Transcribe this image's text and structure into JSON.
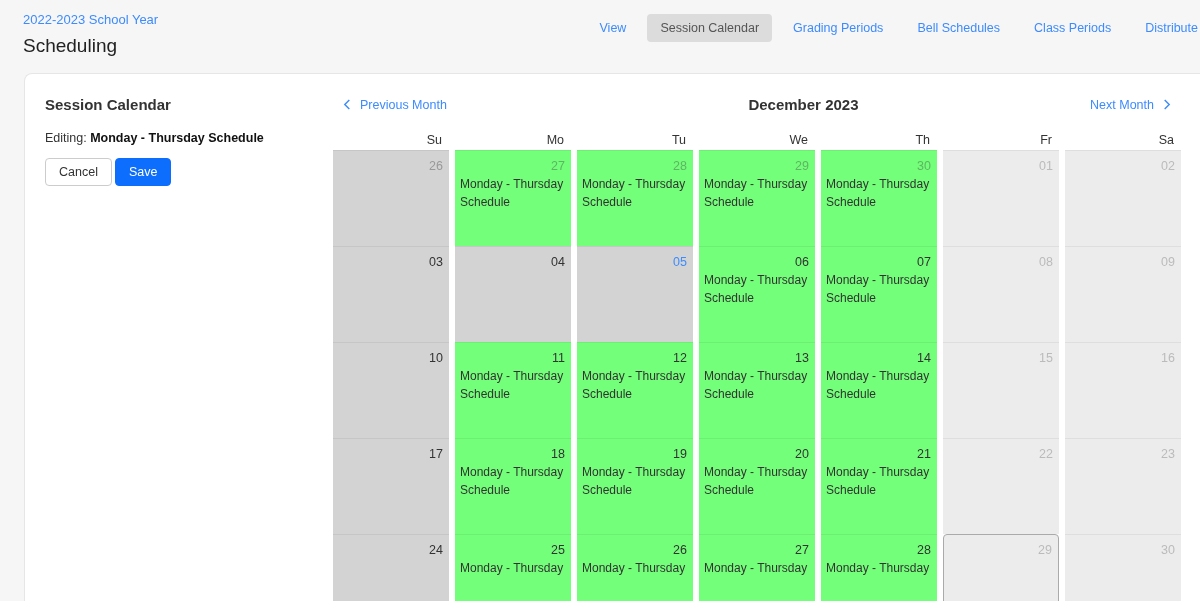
{
  "header": {
    "breadcrumb": "2022-2023 School Year",
    "title": "Scheduling"
  },
  "tabs": [
    {
      "label": "View",
      "selected": false
    },
    {
      "label": "Session Calendar",
      "selected": true
    },
    {
      "label": "Grading Periods",
      "selected": false
    },
    {
      "label": "Bell Schedules",
      "selected": false
    },
    {
      "label": "Class Periods",
      "selected": false
    },
    {
      "label": "Distribute",
      "selected": false
    }
  ],
  "panel": {
    "title": "Session Calendar",
    "editing_label": "Editing:",
    "editing_value": "Monday - Thursday Schedule",
    "buttons": [
      {
        "label": "Cancel",
        "kind": "secondary"
      },
      {
        "label": "Save",
        "kind": "primary"
      }
    ]
  },
  "calendar": {
    "prev": "Previous Month",
    "month": "December 2023",
    "next": "Next Month",
    "weekdays": [
      "Su",
      "Mo",
      "Tu",
      "We",
      "Th",
      "Fr",
      "Sa"
    ],
    "weeks": [
      [
        {
          "day": "26",
          "scheduled": false,
          "weekend": false,
          "outside": true,
          "today": false,
          "selected": false
        },
        {
          "day": "27",
          "scheduled": true,
          "weekend": false,
          "outside": true,
          "today": false,
          "selected": false,
          "schedule": "Monday - Thursday Schedule"
        },
        {
          "day": "28",
          "scheduled": true,
          "weekend": false,
          "outside": true,
          "today": false,
          "selected": false,
          "schedule": "Monday - Thursday Schedule"
        },
        {
          "day": "29",
          "scheduled": true,
          "weekend": false,
          "outside": true,
          "today": false,
          "selected": false,
          "schedule": "Monday - Thursday Schedule"
        },
        {
          "day": "30",
          "scheduled": true,
          "weekend": false,
          "outside": true,
          "today": false,
          "selected": false,
          "schedule": "Monday - Thursday Schedule"
        },
        {
          "day": "01",
          "scheduled": false,
          "weekend": true,
          "outside": false,
          "today": false,
          "selected": false
        },
        {
          "day": "02",
          "scheduled": false,
          "weekend": true,
          "outside": false,
          "today": false,
          "selected": false
        }
      ],
      [
        {
          "day": "03",
          "scheduled": false,
          "weekend": false,
          "outside": false,
          "today": false,
          "selected": false
        },
        {
          "day": "04",
          "scheduled": false,
          "weekend": false,
          "outside": false,
          "today": false,
          "selected": false
        },
        {
          "day": "05",
          "scheduled": false,
          "weekend": false,
          "outside": false,
          "today": true,
          "selected": false
        },
        {
          "day": "06",
          "scheduled": true,
          "weekend": false,
          "outside": false,
          "today": false,
          "selected": false,
          "schedule": "Monday - Thursday Schedule"
        },
        {
          "day": "07",
          "scheduled": true,
          "weekend": false,
          "outside": false,
          "today": false,
          "selected": false,
          "schedule": "Monday - Thursday Schedule"
        },
        {
          "day": "08",
          "scheduled": false,
          "weekend": true,
          "outside": false,
          "today": false,
          "selected": false
        },
        {
          "day": "09",
          "scheduled": false,
          "weekend": true,
          "outside": false,
          "today": false,
          "selected": false
        }
      ],
      [
        {
          "day": "10",
          "scheduled": false,
          "weekend": false,
          "outside": false,
          "today": false,
          "selected": false
        },
        {
          "day": "11",
          "scheduled": true,
          "weekend": false,
          "outside": false,
          "today": false,
          "selected": false,
          "schedule": "Monday - Thursday Schedule"
        },
        {
          "day": "12",
          "scheduled": true,
          "weekend": false,
          "outside": false,
          "today": false,
          "selected": false,
          "schedule": "Monday - Thursday Schedule"
        },
        {
          "day": "13",
          "scheduled": true,
          "weekend": false,
          "outside": false,
          "today": false,
          "selected": false,
          "schedule": "Monday - Thursday Schedule"
        },
        {
          "day": "14",
          "scheduled": true,
          "weekend": false,
          "outside": false,
          "today": false,
          "selected": false,
          "schedule": "Monday - Thursday Schedule"
        },
        {
          "day": "15",
          "scheduled": false,
          "weekend": true,
          "outside": false,
          "today": false,
          "selected": false
        },
        {
          "day": "16",
          "scheduled": false,
          "weekend": true,
          "outside": false,
          "today": false,
          "selected": false
        }
      ],
      [
        {
          "day": "17",
          "scheduled": false,
          "weekend": false,
          "outside": false,
          "today": false,
          "selected": false
        },
        {
          "day": "18",
          "scheduled": true,
          "weekend": false,
          "outside": false,
          "today": false,
          "selected": false,
          "schedule": "Monday - Thursday Schedule"
        },
        {
          "day": "19",
          "scheduled": true,
          "weekend": false,
          "outside": false,
          "today": false,
          "selected": false,
          "schedule": "Monday - Thursday Schedule"
        },
        {
          "day": "20",
          "scheduled": true,
          "weekend": false,
          "outside": false,
          "today": false,
          "selected": false,
          "schedule": "Monday - Thursday Schedule"
        },
        {
          "day": "21",
          "scheduled": true,
          "weekend": false,
          "outside": false,
          "today": false,
          "selected": false,
          "schedule": "Monday - Thursday Schedule"
        },
        {
          "day": "22",
          "scheduled": false,
          "weekend": true,
          "outside": false,
          "today": false,
          "selected": false
        },
        {
          "day": "23",
          "scheduled": false,
          "weekend": true,
          "outside": false,
          "today": false,
          "selected": false
        }
      ],
      [
        {
          "day": "24",
          "scheduled": false,
          "weekend": false,
          "outside": false,
          "today": false,
          "selected": false
        },
        {
          "day": "25",
          "scheduled": true,
          "weekend": false,
          "outside": false,
          "today": false,
          "selected": false,
          "schedule": "Monday - Thursday"
        },
        {
          "day": "26",
          "scheduled": true,
          "weekend": false,
          "outside": false,
          "today": false,
          "selected": false,
          "schedule": "Monday - Thursday"
        },
        {
          "day": "27",
          "scheduled": true,
          "weekend": false,
          "outside": false,
          "today": false,
          "selected": false,
          "schedule": "Monday - Thursday"
        },
        {
          "day": "28",
          "scheduled": true,
          "weekend": false,
          "outside": false,
          "today": false,
          "selected": false,
          "schedule": "Monday - Thursday"
        },
        {
          "day": "29",
          "scheduled": false,
          "weekend": true,
          "outside": false,
          "today": false,
          "selected": true
        },
        {
          "day": "30",
          "scheduled": false,
          "weekend": true,
          "outside": false,
          "today": false,
          "selected": false
        }
      ]
    ]
  }
}
